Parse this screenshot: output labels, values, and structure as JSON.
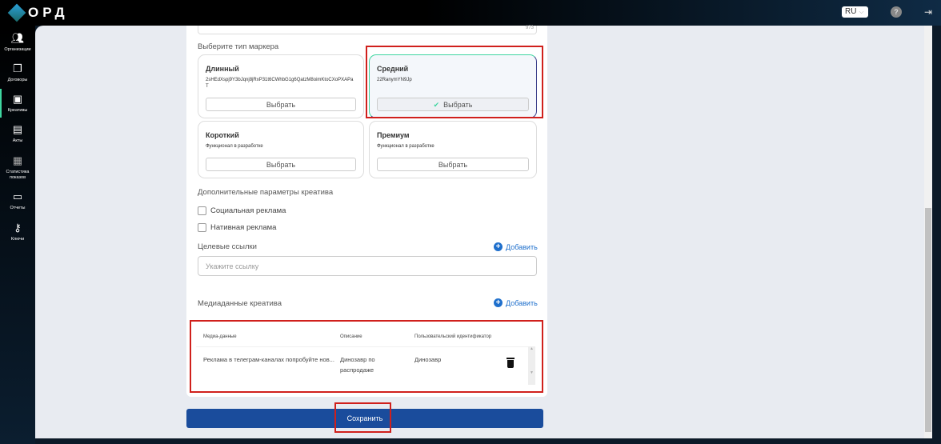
{
  "header": {
    "logo": "ОРД",
    "language": "RU",
    "help": "?"
  },
  "sidebar": {
    "items": [
      {
        "label": "Организации",
        "icon": "users-icon"
      },
      {
        "label": "Договоры",
        "icon": "documents-icon"
      },
      {
        "label": "Креативы",
        "icon": "image-icon",
        "active": true
      },
      {
        "label": "Акты",
        "icon": "file-icon"
      },
      {
        "label": "Статистика показов",
        "icon": "stats-icon"
      },
      {
        "label": "Отчеты",
        "icon": "report-icon"
      },
      {
        "label": "Ключи",
        "icon": "key-icon"
      }
    ]
  },
  "form": {
    "textarea_counter": "973",
    "marker_label": "Выберите тип маркера",
    "markers": [
      {
        "title": "Длинный",
        "desc": "2sHEdXspj9Y3bJqnj8jRxP31t6CWhbG1g6QatzM8oimKtoCXoPXAPaT",
        "button": "Выбрать"
      },
      {
        "title": "Средний",
        "desc": "22RanymYN9Jp",
        "button": "Выбрать",
        "selected": true
      },
      {
        "title": "Короткий",
        "desc": "Функционал в разработке",
        "button": "Выбрать"
      },
      {
        "title": "Премиум",
        "desc": "Функционал в разработке",
        "button": "Выбрать"
      }
    ],
    "extra_label": "Дополнительные параметры креатива",
    "checkboxes": [
      "Социальная реклама",
      "Нативная реклама"
    ],
    "links_label": "Целевые ссылки",
    "add_label": "Добавить",
    "link_placeholder": "Укажите ссылку",
    "media_label": "Медиаданные креатива",
    "table": {
      "headers": [
        "Медиа-данные",
        "Описание",
        "Пользовательский идентификатор"
      ],
      "rows": [
        {
          "media": "Реклама в телеграм-каналах попробуйте нов...",
          "desc": "Динозавр по распродаже",
          "id": "Динозавр"
        }
      ]
    },
    "save": "Сохранить"
  }
}
